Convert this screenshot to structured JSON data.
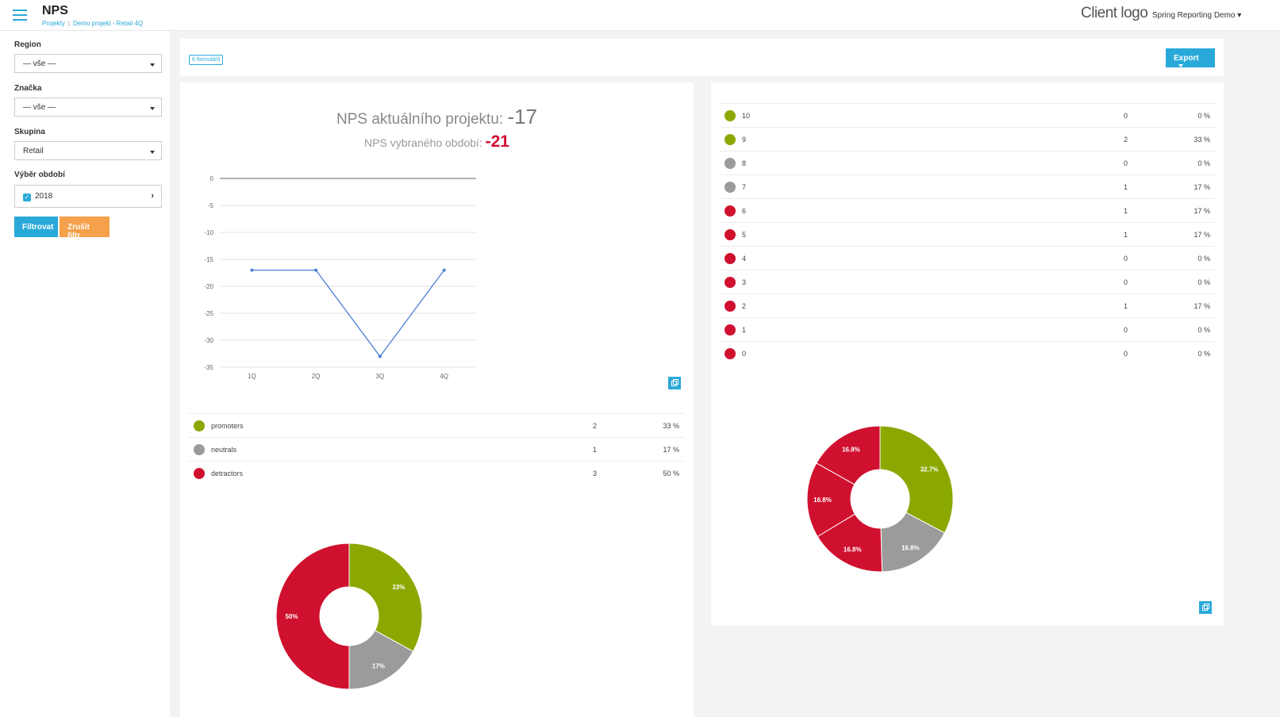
{
  "header": {
    "title": "NPS",
    "breadcrumb": [
      "Projekty",
      "Demo projekt - Retail 4Q"
    ],
    "client_logo": "Client logo",
    "user_menu": "Spring Reporting Demo"
  },
  "sidebar": {
    "filters": [
      {
        "label": "Region",
        "value": "— vše —"
      },
      {
        "label": "Značka",
        "value": "— vše —"
      },
      {
        "label": "Skupina",
        "value": "Retail"
      }
    ],
    "period_label": "Výběr období",
    "period_value": "2018",
    "filter_button": "Filtrovat",
    "reset_button": "Zrušit filtr"
  },
  "toolbar": {
    "badge": "6 formulářů",
    "export_label": "Export"
  },
  "nps": {
    "project_label": "NPS aktuálního projektu:",
    "project_value": "-17",
    "period_label": "NPS vybraného období:",
    "period_value": "-21"
  },
  "colors": {
    "promoter": "#8aa800",
    "neutral": "#9b9b9b",
    "detractor": "#d0102f",
    "accent": "#29a9d9",
    "line": "#4a7fd4"
  },
  "chart_data": [
    {
      "type": "line",
      "categories": [
        "1Q",
        "2Q",
        "3Q",
        "4Q"
      ],
      "values": [
        -17,
        -17,
        -33,
        -17
      ],
      "yticks": [
        0,
        -5,
        -10,
        -15,
        -20,
        -25,
        -30,
        -35
      ],
      "ylim": [
        -35,
        0
      ],
      "grid": true
    },
    {
      "type": "pie",
      "labels": [
        "promoters",
        "neutrals",
        "detractors"
      ],
      "values": [
        33,
        17,
        50
      ],
      "slice_labels": [
        "33%",
        "17%",
        "50%"
      ],
      "colors": [
        "#8aa800",
        "#9b9b9b",
        "#d0102f"
      ]
    },
    {
      "type": "pie",
      "values": [
        32.7,
        16.8,
        16.8,
        16.8,
        16.8
      ],
      "slice_labels": [
        "32.7%",
        "16.8%",
        "16.8%",
        "16.8%",
        "16.8%"
      ],
      "colors": [
        "#8aa800",
        "#9b9b9b",
        "#d0102f",
        "#d0102f",
        "#d0102f"
      ]
    }
  ],
  "category_table": [
    {
      "name": "promoters",
      "count": "2",
      "pct": "33 %",
      "color": "#8aa800"
    },
    {
      "name": "neutrals",
      "count": "1",
      "pct": "17 %",
      "color": "#9b9b9b"
    },
    {
      "name": "detractors",
      "count": "3",
      "pct": "50 %",
      "color": "#d0102f"
    }
  ],
  "score_table": [
    {
      "score": "10",
      "count": "0",
      "pct": "0 %",
      "color": "#8aa800"
    },
    {
      "score": "9",
      "count": "2",
      "pct": "33 %",
      "color": "#8aa800"
    },
    {
      "score": "8",
      "count": "0",
      "pct": "0 %",
      "color": "#9b9b9b"
    },
    {
      "score": "7",
      "count": "1",
      "pct": "17 %",
      "color": "#9b9b9b"
    },
    {
      "score": "6",
      "count": "1",
      "pct": "17 %",
      "color": "#d0102f"
    },
    {
      "score": "5",
      "count": "1",
      "pct": "17 %",
      "color": "#d0102f"
    },
    {
      "score": "4",
      "count": "0",
      "pct": "0 %",
      "color": "#d0102f"
    },
    {
      "score": "3",
      "count": "0",
      "pct": "0 %",
      "color": "#d0102f"
    },
    {
      "score": "2",
      "count": "1",
      "pct": "17 %",
      "color": "#d0102f"
    },
    {
      "score": "1",
      "count": "0",
      "pct": "0 %",
      "color": "#d0102f"
    },
    {
      "score": "0",
      "count": "0",
      "pct": "0 %",
      "color": "#d0102f"
    }
  ]
}
